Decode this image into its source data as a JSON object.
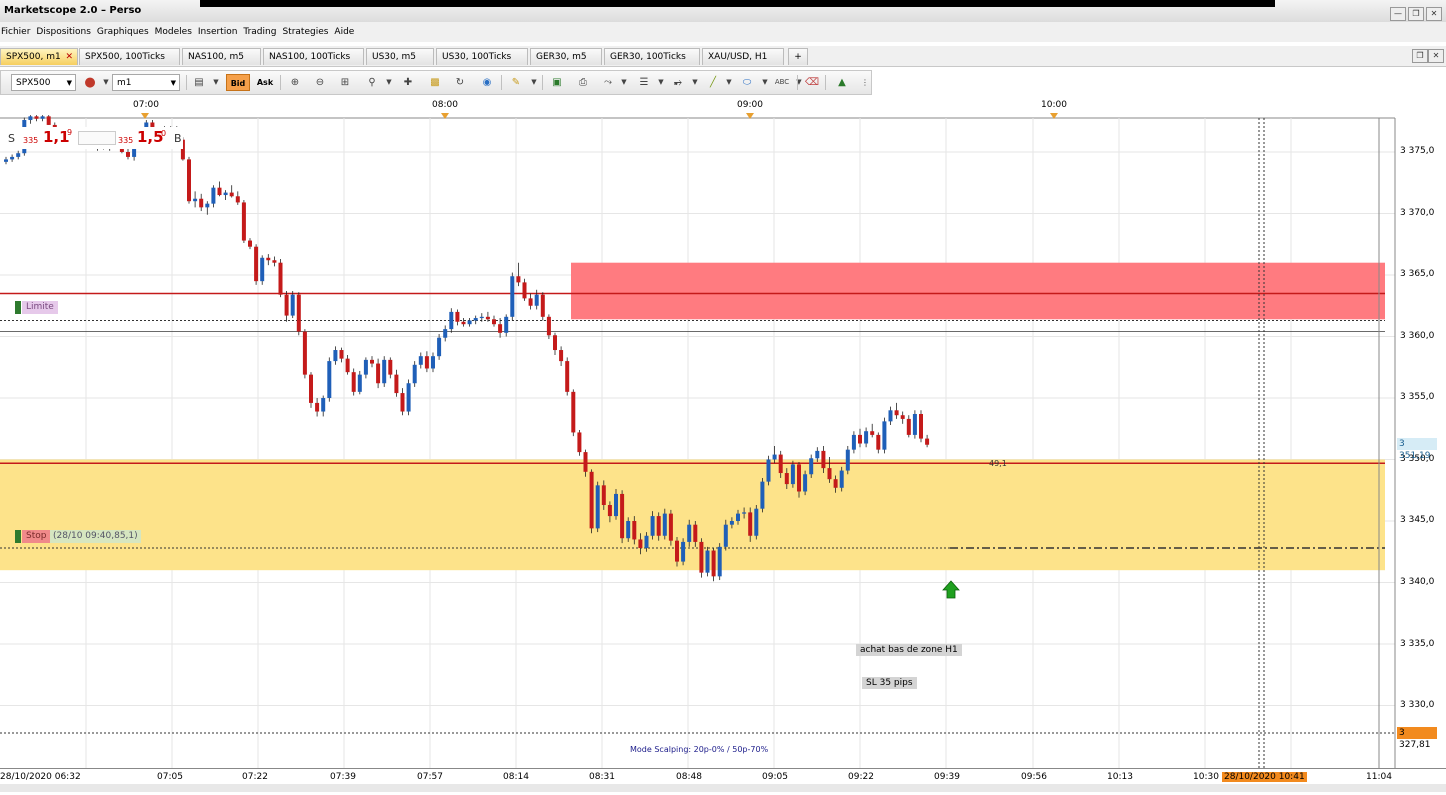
{
  "window": {
    "title": "Marketscope 2.0 – Perso"
  },
  "menu": [
    "Fichier",
    "Dispositions",
    "Graphiques",
    "Modeles",
    "Insertion",
    "Trading",
    "Strategies",
    "Aide"
  ],
  "tabs": [
    {
      "label": "SPX500, m1",
      "active": true
    },
    {
      "label": "SPX500, 100Ticks"
    },
    {
      "label": "NAS100, m5"
    },
    {
      "label": "NAS100, 100Ticks"
    },
    {
      "label": "US30, m5"
    },
    {
      "label": "US30, 100Ticks"
    },
    {
      "label": "GER30, m5"
    },
    {
      "label": "GER30, 100Ticks"
    },
    {
      "label": "XAU/USD, H1"
    }
  ],
  "toolbar": {
    "instrument": "SPX500",
    "timeframe": "m1",
    "bid_label": "Bid",
    "ask_label": "Ask"
  },
  "top_axis": [
    "07:00",
    "08:00",
    "09:00",
    "10:00"
  ],
  "price_axis": [
    "3 375,0",
    "3 370,0",
    "3 365,0",
    "3 360,0",
    "3 355,0",
    "3 350,0",
    "3 345,0",
    "3 340,0",
    "3 335,0",
    "3 330,0"
  ],
  "price_boxes": {
    "current": "3 351,19",
    "crosshair": "3 327,81"
  },
  "bid_ask": {
    "s_label": "S",
    "small": "335",
    "big": "1,1",
    "sup": "9",
    "small2": "335",
    "big2": "1,5",
    "sup2": "0",
    "b_label": "B"
  },
  "orders": {
    "limite": "Limite",
    "stop": "Stop",
    "stop_info": "(28/10 09:40,85,1)",
    "pips_tag": "49,1"
  },
  "annotations": {
    "achat": "achat bas de zone H1",
    "sl": "SL 35 pips"
  },
  "mode_text": "Mode Scalping: 20p-0% / 50p-70%",
  "x_axis": [
    "28/10/2020 06:32",
    "07:05",
    "07:22",
    "07:39",
    "07:57",
    "08:14",
    "08:31",
    "08:48",
    "09:05",
    "09:22",
    "09:39",
    "09:56",
    "10:13",
    "10:30",
    "28/10/2020 10:41",
    "11:04"
  ],
  "colors": {
    "bull": "#1f5fb8",
    "bear": "#c41a1a",
    "supply_zone": "#ff7b80",
    "demand_zone": "#fde38a",
    "active_tab": "#f6cf60"
  },
  "chart_data": {
    "type": "candlestick",
    "instrument": "SPX500",
    "timeframe": "m1",
    "ylim": [
      3325.5,
      3378
    ],
    "zones": [
      {
        "type": "supply",
        "low": 3361.4,
        "high": 3366.0,
        "start": "08:25"
      },
      {
        "type": "demand",
        "low": 3341.0,
        "high": 3350.0
      }
    ],
    "lines": [
      {
        "label": "Limite",
        "value": 3361.3
      },
      {
        "label": "Stop",
        "value": 3342.8
      },
      {
        "value": 3363.5
      },
      {
        "value": 3349.7
      }
    ],
    "candles": [
      [
        3374.2,
        3374.6,
        3374.0,
        3374.4
      ],
      [
        3374.4,
        3374.8,
        3374.2,
        3374.6
      ],
      [
        3374.6,
        3375.1,
        3374.4,
        3374.9
      ],
      [
        3374.9,
        3377.8,
        3374.7,
        3377.6
      ],
      [
        3377.6,
        3378.0,
        3377.3,
        3377.9
      ],
      [
        3377.9,
        3378.0,
        3377.5,
        3377.7
      ],
      [
        3377.7,
        3378.0,
        3377.5,
        3377.9
      ],
      [
        3377.9,
        3378.0,
        3377.2,
        3377.2
      ],
      [
        3377.2,
        3377.4,
        3376.0,
        3376.2
      ],
      [
        3376.2,
        3376.8,
        3375.9,
        3376.6
      ],
      [
        3376.6,
        3376.9,
        3376.3,
        3376.5
      ],
      [
        3376.5,
        3376.8,
        3376.1,
        3376.3
      ],
      [
        3376.3,
        3376.9,
        3376.0,
        3376.7
      ],
      [
        3376.7,
        3376.9,
        3375.8,
        3375.9
      ],
      [
        3375.9,
        3376.1,
        3375.3,
        3375.4
      ],
      [
        3375.4,
        3375.9,
        3375.1,
        3375.7
      ],
      [
        3375.7,
        3376.0,
        3375.2,
        3375.3
      ],
      [
        3375.3,
        3376.3,
        3375.1,
        3376.1
      ],
      [
        3376.1,
        3376.4,
        3375.6,
        3375.7
      ],
      [
        3375.7,
        3375.9,
        3374.9,
        3375.0
      ],
      [
        3375.0,
        3375.3,
        3374.4,
        3374.6
      ],
      [
        3374.6,
        3375.9,
        3374.3,
        3375.8
      ],
      [
        3375.8,
        3376.8,
        3375.5,
        3376.6
      ],
      [
        3376.6,
        3377.6,
        3376.3,
        3377.4
      ],
      [
        3377.4,
        3377.6,
        3376.6,
        3376.7
      ],
      [
        3376.7,
        3377.0,
        3376.3,
        3376.8
      ],
      [
        3376.8,
        3377.1,
        3376.5,
        3376.9
      ],
      [
        3376.9,
        3377.1,
        3376.6,
        3377.0
      ],
      [
        3377.0,
        3377.1,
        3375.9,
        3376.0
      ],
      [
        3376.0,
        3376.2,
        3374.3,
        3374.4
      ],
      [
        3374.4,
        3374.6,
        3370.8,
        3371.0
      ],
      [
        3371.0,
        3371.8,
        3370.5,
        3371.2
      ],
      [
        3371.2,
        3371.6,
        3370.2,
        3370.5
      ],
      [
        3370.5,
        3371.0,
        3369.9,
        3370.8
      ],
      [
        3370.8,
        3372.3,
        3370.5,
        3372.1
      ],
      [
        3372.1,
        3372.6,
        3371.4,
        3371.5
      ],
      [
        3371.5,
        3371.9,
        3371.1,
        3371.7
      ],
      [
        3371.7,
        3372.3,
        3371.3,
        3371.4
      ],
      [
        3371.4,
        3371.8,
        3370.7,
        3370.9
      ],
      [
        3370.9,
        3371.1,
        3367.6,
        3367.8
      ],
      [
        3367.8,
        3368.0,
        3367.1,
        3367.3
      ],
      [
        3367.3,
        3367.5,
        3364.2,
        3364.5
      ],
      [
        3364.5,
        3366.6,
        3364.2,
        3366.4
      ],
      [
        3366.4,
        3366.7,
        3365.8,
        3366.2
      ],
      [
        3366.2,
        3366.5,
        3365.7,
        3366.0
      ],
      [
        3366.0,
        3366.3,
        3363.2,
        3363.4
      ],
      [
        3363.4,
        3363.7,
        3361.2,
        3361.7
      ],
      [
        3361.7,
        3363.7,
        3361.5,
        3363.4
      ],
      [
        3363.4,
        3363.6,
        3360.1,
        3360.4
      ],
      [
        3360.4,
        3360.6,
        3356.6,
        3356.9
      ],
      [
        3356.9,
        3357.1,
        3354.2,
        3354.6
      ],
      [
        3354.6,
        3355.0,
        3353.5,
        3353.9
      ],
      [
        3353.9,
        3355.2,
        3353.5,
        3355.0
      ],
      [
        3355.0,
        3358.3,
        3354.7,
        3358.0
      ],
      [
        3358.0,
        3359.2,
        3357.7,
        3358.9
      ],
      [
        3358.9,
        3359.1,
        3357.9,
        3358.2
      ],
      [
        3358.2,
        3358.5,
        3356.9,
        3357.1
      ],
      [
        3357.1,
        3357.4,
        3355.2,
        3355.5
      ],
      [
        3355.5,
        3357.2,
        3355.3,
        3356.9
      ],
      [
        3356.9,
        3358.3,
        3356.6,
        3358.1
      ],
      [
        3358.1,
        3358.4,
        3357.5,
        3357.8
      ],
      [
        3357.8,
        3358.2,
        3355.8,
        3356.2
      ],
      [
        3356.2,
        3358.4,
        3355.9,
        3358.1
      ],
      [
        3358.1,
        3358.3,
        3356.6,
        3356.9
      ],
      [
        3356.9,
        3357.3,
        3355.1,
        3355.4
      ],
      [
        3355.4,
        3355.8,
        3353.6,
        3353.9
      ],
      [
        3353.9,
        3356.5,
        3353.6,
        3356.2
      ],
      [
        3356.2,
        3358.0,
        3355.9,
        3357.7
      ],
      [
        3357.7,
        3358.7,
        3357.4,
        3358.4
      ],
      [
        3358.4,
        3358.8,
        3357.1,
        3357.4
      ],
      [
        3357.4,
        3358.7,
        3357.1,
        3358.4
      ],
      [
        3358.4,
        3360.2,
        3358.1,
        3359.9
      ],
      [
        3359.9,
        3360.9,
        3359.6,
        3360.6
      ],
      [
        3360.6,
        3362.3,
        3360.3,
        3362.0
      ],
      [
        3362.0,
        3362.2,
        3360.9,
        3361.2
      ],
      [
        3361.2,
        3361.5,
        3360.8,
        3361.0
      ],
      [
        3361.0,
        3361.5,
        3360.8,
        3361.3
      ],
      [
        3361.3,
        3361.7,
        3361.0,
        3361.5
      ],
      [
        3361.5,
        3361.9,
        3361.2,
        3361.6
      ],
      [
        3361.6,
        3362.0,
        3361.2,
        3361.4
      ],
      [
        3361.4,
        3361.7,
        3360.8,
        3361.0
      ],
      [
        3361.0,
        3361.5,
        3359.9,
        3360.3
      ],
      [
        3360.3,
        3361.8,
        3360.0,
        3361.6
      ],
      [
        3361.6,
        3365.2,
        3361.3,
        3364.9
      ],
      [
        3364.9,
        3366.0,
        3364.1,
        3364.4
      ],
      [
        3364.4,
        3364.7,
        3362.9,
        3363.1
      ],
      [
        3363.1,
        3363.5,
        3362.2,
        3362.5
      ],
      [
        3362.5,
        3363.8,
        3362.2,
        3363.4
      ],
      [
        3363.4,
        3363.6,
        3361.3,
        3361.6
      ],
      [
        3361.6,
        3361.8,
        3359.8,
        3360.1
      ],
      [
        3360.1,
        3360.3,
        3358.5,
        3358.9
      ],
      [
        3358.9,
        3359.2,
        3357.6,
        3358.0
      ],
      [
        3358.0,
        3358.3,
        3355.2,
        3355.5
      ],
      [
        3355.5,
        3355.7,
        3351.9,
        3352.2
      ],
      [
        3352.2,
        3352.4,
        3350.3,
        3350.6
      ],
      [
        3350.6,
        3350.8,
        3348.6,
        3349.0
      ],
      [
        3349.0,
        3349.2,
        3344.0,
        3344.4
      ],
      [
        3344.4,
        3348.2,
        3344.1,
        3347.9
      ],
      [
        3347.9,
        3348.3,
        3345.9,
        3346.3
      ],
      [
        3346.3,
        3346.6,
        3344.9,
        3345.4
      ],
      [
        3345.4,
        3347.6,
        3345.1,
        3347.2
      ],
      [
        3347.2,
        3347.5,
        3343.2,
        3343.6
      ],
      [
        3343.6,
        3345.3,
        3343.3,
        3345.0
      ],
      [
        3345.0,
        3345.4,
        3343.1,
        3343.5
      ],
      [
        3343.5,
        3344.0,
        3342.3,
        3342.8
      ],
      [
        3342.8,
        3344.1,
        3342.5,
        3343.8
      ],
      [
        3343.8,
        3345.8,
        3343.5,
        3345.4
      ],
      [
        3345.4,
        3345.7,
        3343.4,
        3343.8
      ],
      [
        3343.8,
        3346.0,
        3343.5,
        3345.6
      ],
      [
        3345.6,
        3345.9,
        3343.0,
        3343.4
      ],
      [
        3343.4,
        3343.7,
        3341.3,
        3341.7
      ],
      [
        3341.7,
        3343.6,
        3341.4,
        3343.3
      ],
      [
        3343.3,
        3345.1,
        3342.9,
        3344.7
      ],
      [
        3344.7,
        3345.0,
        3342.9,
        3343.3
      ],
      [
        3343.3,
        3343.6,
        3340.4,
        3340.8
      ],
      [
        3340.8,
        3342.9,
        3340.5,
        3342.6
      ],
      [
        3342.6,
        3342.8,
        3340.1,
        3340.5
      ],
      [
        3340.5,
        3343.2,
        3340.2,
        3342.9
      ],
      [
        3342.9,
        3345.1,
        3342.6,
        3344.7
      ],
      [
        3344.7,
        3345.3,
        3344.4,
        3345.0
      ],
      [
        3345.0,
        3345.9,
        3344.7,
        3345.6
      ],
      [
        3345.6,
        3346.1,
        3345.2,
        3345.7
      ],
      [
        3345.7,
        3346.1,
        3343.3,
        3343.8
      ],
      [
        3343.8,
        3346.3,
        3343.5,
        3346.0
      ],
      [
        3346.0,
        3348.5,
        3345.7,
        3348.2
      ],
      [
        3348.2,
        3350.3,
        3347.9,
        3350.0
      ],
      [
        3350.0,
        3351.1,
        3349.7,
        3350.4
      ],
      [
        3350.4,
        3350.7,
        3348.5,
        3348.9
      ],
      [
        3348.9,
        3349.3,
        3347.6,
        3348.0
      ],
      [
        3348.0,
        3349.9,
        3347.7,
        3349.6
      ],
      [
        3349.6,
        3349.8,
        3346.9,
        3347.4
      ],
      [
        3347.4,
        3349.1,
        3347.1,
        3348.8
      ],
      [
        3348.8,
        3350.4,
        3348.5,
        3350.1
      ],
      [
        3350.1,
        3351.0,
        3349.8,
        3350.7
      ],
      [
        3350.7,
        3351.1,
        3348.9,
        3349.3
      ],
      [
        3349.3,
        3350.2,
        3348.1,
        3348.4
      ],
      [
        3348.4,
        3348.7,
        3347.3,
        3347.7
      ],
      [
        3347.7,
        3349.4,
        3347.4,
        3349.1
      ],
      [
        3349.1,
        3351.1,
        3348.8,
        3350.8
      ],
      [
        3350.8,
        3352.3,
        3350.5,
        3352.0
      ],
      [
        3352.0,
        3352.5,
        3351.0,
        3351.3
      ],
      [
        3351.3,
        3352.6,
        3351.0,
        3352.3
      ],
      [
        3352.3,
        3352.9,
        3351.8,
        3352.0
      ],
      [
        3352.0,
        3352.2,
        3350.5,
        3350.8
      ],
      [
        3350.8,
        3353.4,
        3350.5,
        3353.1
      ],
      [
        3353.1,
        3354.3,
        3352.8,
        3354.0
      ],
      [
        3354.0,
        3354.6,
        3353.3,
        3353.6
      ],
      [
        3353.6,
        3353.9,
        3352.9,
        3353.3
      ],
      [
        3353.3,
        3353.6,
        3351.8,
        3352.0
      ],
      [
        3352.0,
        3354.0,
        3351.7,
        3353.7
      ],
      [
        3353.7,
        3354.0,
        3351.4,
        3351.7
      ],
      [
        3351.7,
        3352.0,
        3351.0,
        3351.2
      ]
    ]
  }
}
